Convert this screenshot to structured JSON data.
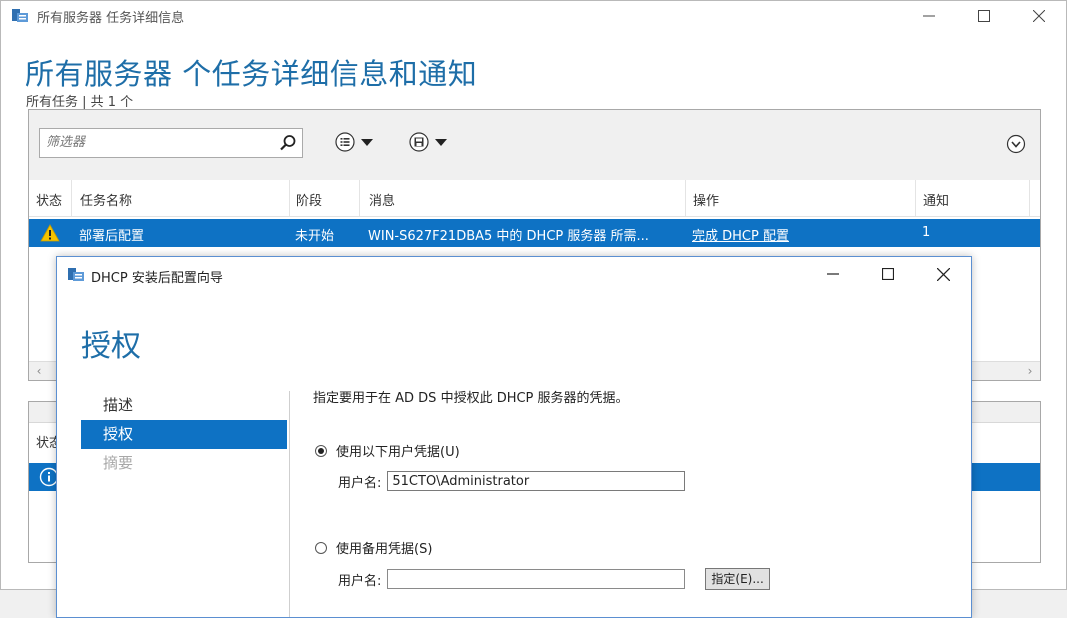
{
  "main_window": {
    "title": "所有服务器 任务详细信息",
    "controls": {
      "minimize": "—",
      "maximize": "☐",
      "close": "✕"
    },
    "heading": "所有服务器 个任务详细信息和通知",
    "count": "所有任务 | 共 1 个"
  },
  "toolbar": {
    "filter_placeholder": "筛选器",
    "list_view_icon": "list-options-icon",
    "save_icon": "save-icon",
    "expand_icon": "chevron-down-circle-icon"
  },
  "task_table": {
    "columns": [
      "状态",
      "任务名称",
      "阶段",
      "消息",
      "操作",
      "通知"
    ],
    "row": {
      "status_icon": "warning-icon",
      "task_name": "部署后配置",
      "stage": "未开始",
      "message": "WIN-S627F21DBA5 中的 DHCP 服务器 所需...",
      "action": "完成 DHCP 配置",
      "notifications": "1"
    }
  },
  "notification_panel": {
    "columns": [
      "状态"
    ],
    "row_icon": "info-icon"
  },
  "dialog": {
    "title": "DHCP 安装后配置向导",
    "controls": {
      "minimize": "—",
      "maximize": "☐",
      "close": "✕"
    },
    "heading": "授权",
    "nav": [
      {
        "label": "描述",
        "state": "normal"
      },
      {
        "label": "授权",
        "state": "active"
      },
      {
        "label": "摘要",
        "state": "disabled"
      }
    ],
    "instruction": "指定要用于在 AD DS 中授权此 DHCP 服务器的凭据。",
    "option_current": {
      "label": "使用以下用户凭据(U)",
      "checked": true
    },
    "username_label": "用户名:",
    "username_value": "51CTO\\Administrator",
    "option_alternate": {
      "label": "使用备用凭据(S)",
      "checked": false
    },
    "alt_username_label": "用户名:",
    "alt_username_value": "",
    "specify_button": "指定(E)..."
  },
  "colors": {
    "accent": "#0e72c4",
    "heading": "#1e6ea8"
  }
}
